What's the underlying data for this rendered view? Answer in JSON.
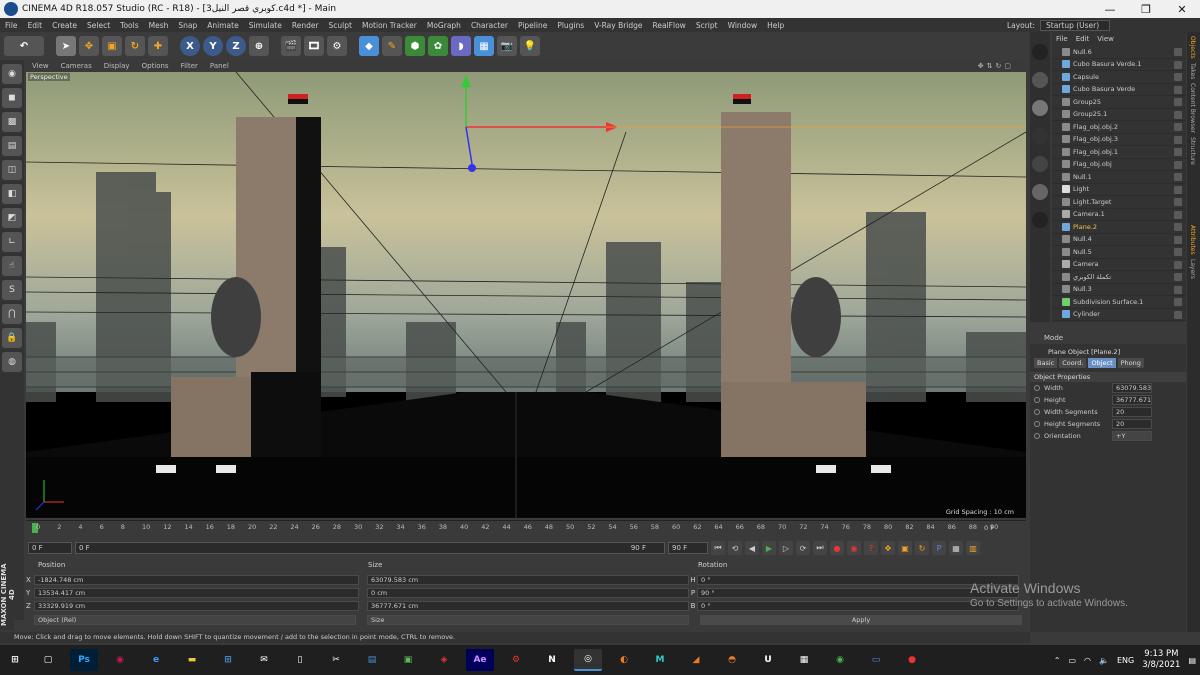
{
  "window": {
    "title": "CINEMA 4D R18.057 Studio (RC - R18) - [3كوبري قصر النيل.c4d *] - Main",
    "minimize": "—",
    "maximize": "❐",
    "close": "✕"
  },
  "menu": [
    "File",
    "Edit",
    "Create",
    "Select",
    "Tools",
    "Mesh",
    "Snap",
    "Animate",
    "Simulate",
    "Render",
    "Sculpt",
    "Motion Tracker",
    "MoGraph",
    "Character",
    "Pipeline",
    "Plugins",
    "V-Ray Bridge",
    "RealFlow",
    "Script",
    "Window",
    "Help"
  ],
  "layout": {
    "label": "Layout:",
    "value": "Startup (User)"
  },
  "toolbar": {
    "undo": "↶",
    "x": "X",
    "y": "Y",
    "z": "Z"
  },
  "viewport": {
    "menu": [
      "View",
      "Cameras",
      "Display",
      "Options",
      "Filter",
      "Panel"
    ],
    "label": "Perspective",
    "grid_spacing": "Grid Spacing : 10 cm"
  },
  "timeline": {
    "ticks": [
      "0",
      "2",
      "4",
      "6",
      "8",
      "10",
      "12",
      "14",
      "16",
      "18",
      "20",
      "22",
      "24",
      "26",
      "28",
      "30",
      "32",
      "34",
      "36",
      "38",
      "40",
      "42",
      "44",
      "46",
      "48",
      "50",
      "52",
      "54",
      "56",
      "58",
      "60",
      "62",
      "64",
      "66",
      "68",
      "70",
      "72",
      "74",
      "76",
      "78",
      "80",
      "82",
      "84",
      "86",
      "88",
      "90"
    ],
    "frame_end": "0 F",
    "current": "0 F",
    "slider_start": "0 F",
    "slider_end": "90 F",
    "end": "90 F"
  },
  "coords": {
    "position_label": "Position",
    "size_label": "Size",
    "rotation_label": "Rotation",
    "px": "-1824.748 cm",
    "py": "13534.417 cm",
    "pz": "33329.919 cm",
    "sx": "63079.583 cm",
    "sy": "0 cm",
    "sz": "36777.671 cm",
    "rh": "0 °",
    "rp": "90 °",
    "rb": "0 °",
    "ax": "X",
    "ay": "Y",
    "az": "Z",
    "ah": "H",
    "ap": "P",
    "ab": "B",
    "mode": "Object (Rel)",
    "size_mode": "Size",
    "apply": "Apply"
  },
  "status": "Move: Click and drag to move elements. Hold down SHIFT to quantize movement / add to the selection in point mode, CTRL to remove.",
  "object_manager": {
    "menu": [
      "File",
      "Edit",
      "View"
    ],
    "objects": [
      {
        "name": "Null.6",
        "color": "#8a8a8a",
        "sel": false
      },
      {
        "name": "Cubo Basura Verde.1",
        "color": "#6fa8dc",
        "sel": false
      },
      {
        "name": "Capsule",
        "color": "#6fa8dc",
        "sel": false
      },
      {
        "name": "Cubo Basura Verde",
        "color": "#6fa8dc",
        "sel": false
      },
      {
        "name": "Group25",
        "color": "#8a8a8a",
        "sel": false
      },
      {
        "name": "Group25.1",
        "color": "#8a8a8a",
        "sel": false
      },
      {
        "name": "Flag_obj.obj.2",
        "color": "#8a8a8a",
        "sel": false
      },
      {
        "name": "Flag_obj.obj.3",
        "color": "#8a8a8a",
        "sel": false
      },
      {
        "name": "Flag_obj.obj.1",
        "color": "#8a8a8a",
        "sel": false
      },
      {
        "name": "Flag_obj.obj",
        "color": "#8a8a8a",
        "sel": false
      },
      {
        "name": "Null.1",
        "color": "#8a8a8a",
        "sel": false
      },
      {
        "name": "Light",
        "color": "#dddddd",
        "sel": false
      },
      {
        "name": "Light.Target",
        "color": "#8a8a8a",
        "sel": false
      },
      {
        "name": "Camera.1",
        "color": "#aaaaaa",
        "sel": false
      },
      {
        "name": "Plane.2",
        "color": "#6fa8dc",
        "sel": true
      },
      {
        "name": "Null.4",
        "color": "#8a8a8a",
        "sel": false
      },
      {
        "name": "Null.5",
        "color": "#8a8a8a",
        "sel": false
      },
      {
        "name": "Camera",
        "color": "#aaaaaa",
        "sel": false
      },
      {
        "name": "تكملة الكوبري",
        "color": "#8a8a8a",
        "sel": false
      },
      {
        "name": "Null.3",
        "color": "#8a8a8a",
        "sel": false
      },
      {
        "name": "Subdivision Surface.1",
        "color": "#6fcf6f",
        "sel": false
      },
      {
        "name": "Cylinder",
        "color": "#6fa8dc",
        "sel": false
      }
    ]
  },
  "side_tabs": [
    "Objects",
    "Takes",
    "Content Browser",
    "Structure"
  ],
  "attr_tabs": [
    "Attributes",
    "Layers"
  ],
  "attributes": {
    "mode": "Mode",
    "title": "Plane Object [Plane.2]",
    "tabs": [
      "Basic",
      "Coord.",
      "Object",
      "Phong"
    ],
    "section": "Object Properties",
    "props": [
      {
        "label": "Width",
        "value": "63079.583"
      },
      {
        "label": "Height",
        "value": "36777.671"
      },
      {
        "label": "Width Segments",
        "value": "20"
      },
      {
        "label": "Height Segments",
        "value": "20"
      },
      {
        "label": "Orientation",
        "value": "+Y"
      }
    ]
  },
  "watermark": {
    "line1": "Activate Windows",
    "line2": "Go to Settings to activate Windows."
  },
  "maxon": "MAXON CINEMA 4D",
  "taskbar": {
    "lang": "ENG",
    "time": "9:13 PM",
    "date": "3/8/2021"
  }
}
